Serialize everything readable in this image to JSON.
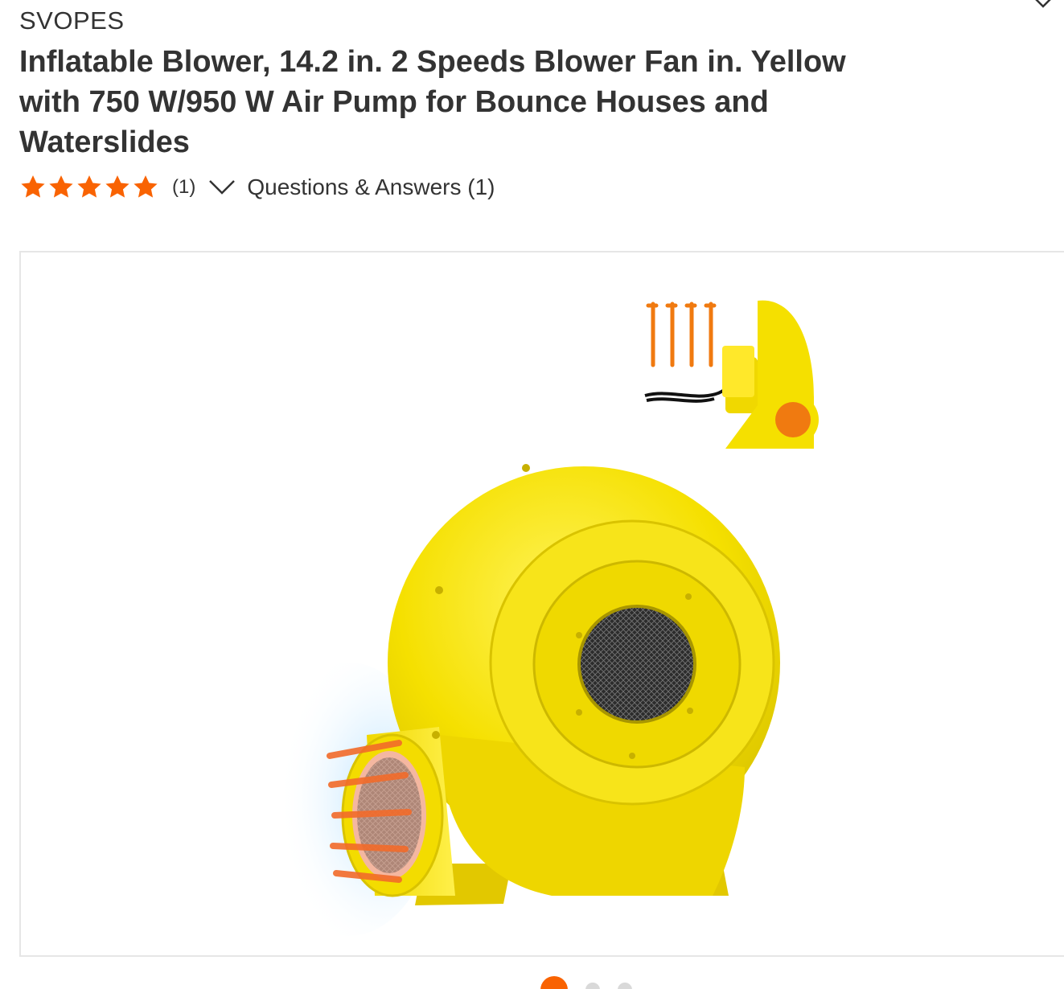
{
  "product": {
    "brand": "SVOPES",
    "title": "Inflatable Blower, 14.2 in. 2 Speeds Blower Fan in. Yellow with 750 W/950 W Air Pump for Bounce Houses and Waterslides",
    "rating": {
      "stars": 5,
      "max_stars": 5,
      "review_count": "(1)"
    },
    "questions_answers_label": "Questions & Answers (1)"
  },
  "gallery": {
    "image_icon": "yellow-inflatable-blower-image",
    "active_index": 0,
    "dot_count": 3
  },
  "colors": {
    "accent": "#f96302",
    "text": "#333333",
    "blower_yellow": "#f5e000"
  }
}
